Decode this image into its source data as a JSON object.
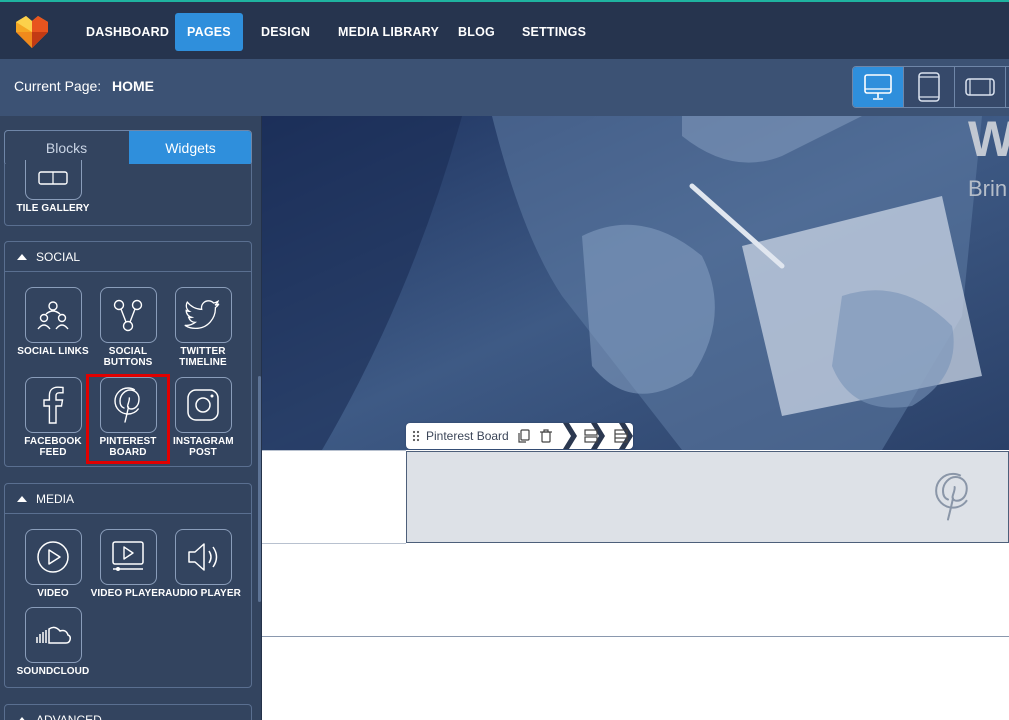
{
  "nav": {
    "items": [
      "DASHBOARD",
      "PAGES",
      "DESIGN",
      "MEDIA LIBRARY",
      "BLOG",
      "SETTINGS"
    ],
    "active": "PAGES"
  },
  "subbar": {
    "current_page_label": "Current Page:",
    "current_page_value": "HOME",
    "devices": [
      "desktop-icon",
      "tablet-icon",
      "mobile-landscape-icon"
    ],
    "active_device": "desktop-icon"
  },
  "sidebar": {
    "tabs": [
      "Blocks",
      "Widgets"
    ],
    "active_tab": "Widgets",
    "gallery_partial": {
      "label": "TILE GALLERY"
    },
    "social": {
      "title": "SOCIAL",
      "widgets": [
        {
          "label": "SOCIAL LINKS",
          "icon": "social-links-icon"
        },
        {
          "label": "SOCIAL BUTTONS",
          "icon": "social-buttons-icon"
        },
        {
          "label": "TWITTER TIMELINE",
          "icon": "twitter-icon"
        },
        {
          "label": "FACEBOOK FEED",
          "icon": "facebook-icon"
        },
        {
          "label": "PINTEREST BOARD",
          "icon": "pinterest-icon"
        },
        {
          "label": "INSTAGRAM POST",
          "icon": "instagram-icon"
        }
      ]
    },
    "media": {
      "title": "MEDIA",
      "widgets": [
        {
          "label": "VIDEO",
          "icon": "video-icon"
        },
        {
          "label": "VIDEO PLAYER",
          "icon": "video-player-icon"
        },
        {
          "label": "AUDIO PLAYER",
          "icon": "audio-player-icon"
        },
        {
          "label": "SOUNDCLOUD",
          "icon": "soundcloud-icon"
        }
      ]
    },
    "advanced": {
      "title": "ADVANCED"
    }
  },
  "canvas": {
    "hero_heading_partial": "W",
    "hero_sub_partial": "Brin",
    "toolbar_label": "Pinterest Board"
  },
  "colors": {
    "nav_bg": "#26344e",
    "active_blue": "#2f8fdc",
    "sidebar_bg": "#33445f",
    "highlight": "#e00000"
  }
}
